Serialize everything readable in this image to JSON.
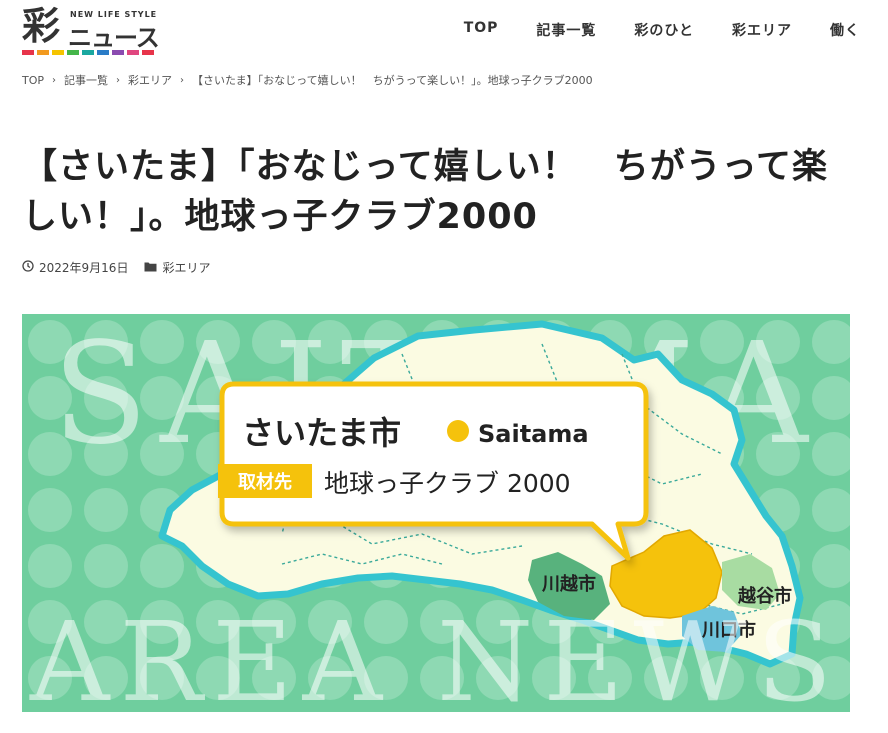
{
  "logo": {
    "kanji": "彩",
    "tagline": "NEW LIFE STYLE",
    "text": "ニュース",
    "dot_colors": [
      "#e7344a",
      "#f29a1f",
      "#f5c400",
      "#44b549",
      "#1aa8a0",
      "#2a7cc7",
      "#8a4bb0",
      "#e0467f",
      "#e7344a"
    ]
  },
  "nav": {
    "items": [
      "TOP",
      "記事一覧",
      "彩のひと",
      "彩エリア",
      "働く"
    ]
  },
  "breadcrumb": {
    "items": [
      "TOP",
      "記事一覧",
      "彩エリア",
      "【さいたま】「おなじって嬉しい！　ちがうって楽しい！」。地球っ子クラブ2000"
    ]
  },
  "article": {
    "title": "【さいたま】「おなじって嬉しい！　ちがうって楽しい！」。地球っ子クラブ2000",
    "date": "2022年9月16日",
    "category": "彩エリア"
  },
  "hero": {
    "bg_word_top": "SAITAMA",
    "bg_word_bottom": "AREA NEWS",
    "city_jp": "さいたま市",
    "city_en": "Saitama",
    "badge": "取材先",
    "place": "地球っ子クラブ 2000",
    "label_kawagoe": "川越市",
    "label_koshigaya": "越谷市",
    "label_kawaguchi": "川口市",
    "colors": {
      "bg": "#6fce9e",
      "dots": "#8ed9b3",
      "map_fill": "#fbfbe2",
      "map_outline": "#35c4cf",
      "saitama": "#f5c20c",
      "kawagoe": "#58b27d",
      "koshigaya": "#a8dca2",
      "kawaguchi": "#6fc4dc",
      "accent": "#f5c20c"
    }
  }
}
